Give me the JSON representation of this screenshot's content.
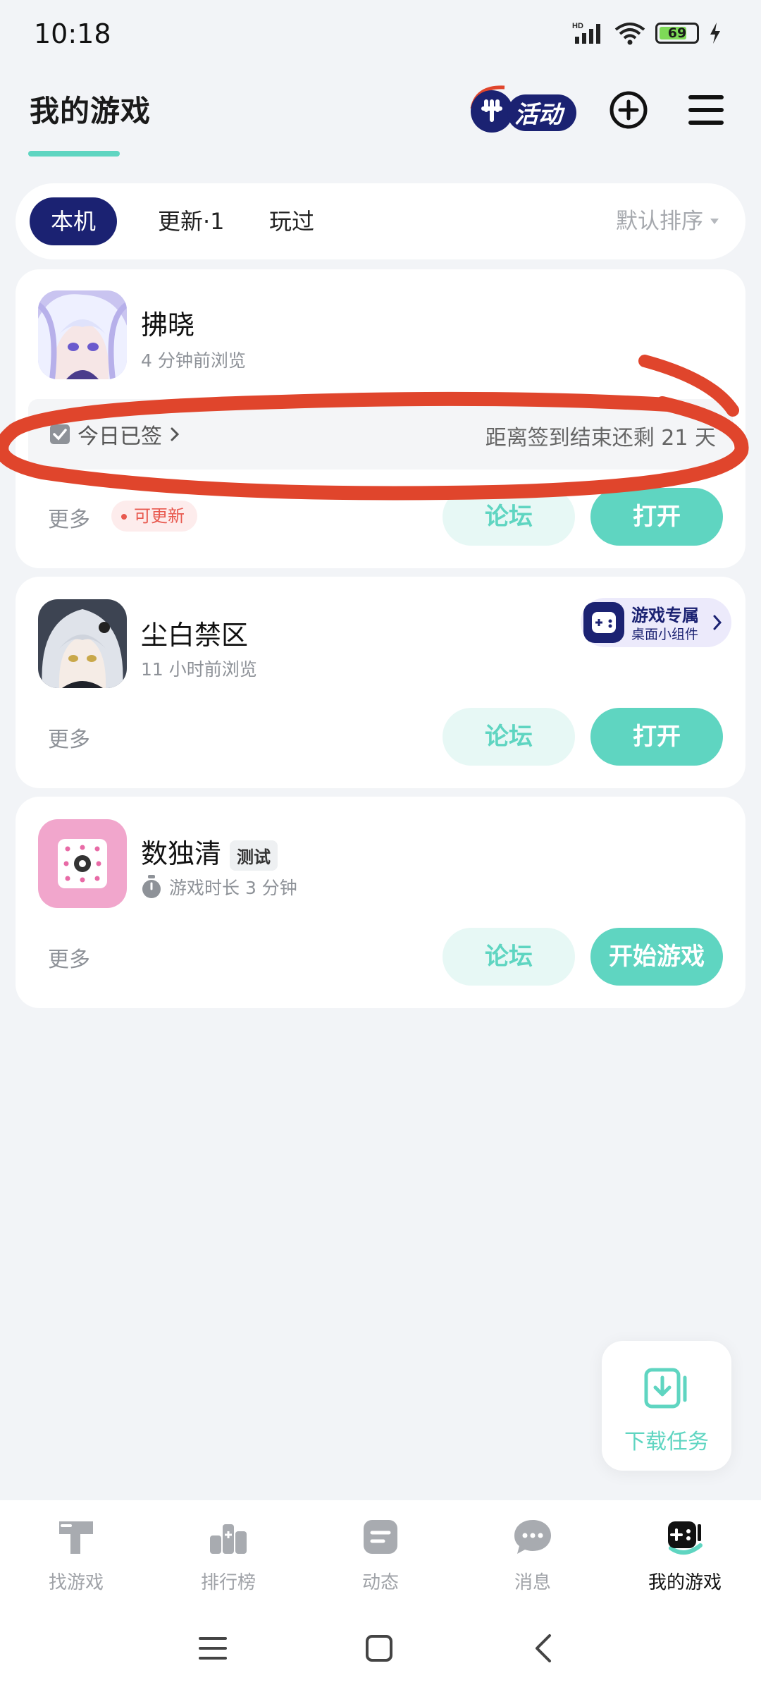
{
  "status": {
    "time": "10:18",
    "battery": "69",
    "network": "HD"
  },
  "header": {
    "title": "我的游戏",
    "activity_label": "活动"
  },
  "tabs": [
    {
      "label": "本机",
      "active": true
    },
    {
      "label": "更新·1",
      "active": false
    },
    {
      "label": "玩过",
      "active": false
    }
  ],
  "sort_label": "默认排序",
  "games": [
    {
      "name": "拂晓",
      "subtitle": "4 分钟前浏览",
      "signin_status": "今日已签",
      "signin_remaining": "距离签到结束还剩 21 天",
      "more": "更多",
      "update_badge": "可更新",
      "forum": "论坛",
      "action": "打开"
    },
    {
      "name": "尘白禁区",
      "subtitle": "11 小时前浏览",
      "widget_title": "游戏专属",
      "widget_sub": "桌面小组件",
      "more": "更多",
      "forum": "论坛",
      "action": "打开"
    },
    {
      "name": "数独清",
      "tag": "测试",
      "subtitle": "游戏时长 3 分钟",
      "more": "更多",
      "forum": "论坛",
      "action": "开始游戏"
    }
  ],
  "download_fab": {
    "label": "下载任务"
  },
  "bottom_nav": [
    {
      "label": "找游戏",
      "icon": "hammer-icon",
      "active": false
    },
    {
      "label": "排行榜",
      "icon": "ranking-icon",
      "active": false
    },
    {
      "label": "动态",
      "icon": "feed-icon",
      "active": false
    },
    {
      "label": "消息",
      "icon": "chat-bubble-icon",
      "active": false
    },
    {
      "label": "我的游戏",
      "icon": "gamepad-icon",
      "active": true
    }
  ],
  "colors": {
    "accent": "#5fd5c1",
    "navy": "#1b2272",
    "annotation": "#e0452c"
  }
}
